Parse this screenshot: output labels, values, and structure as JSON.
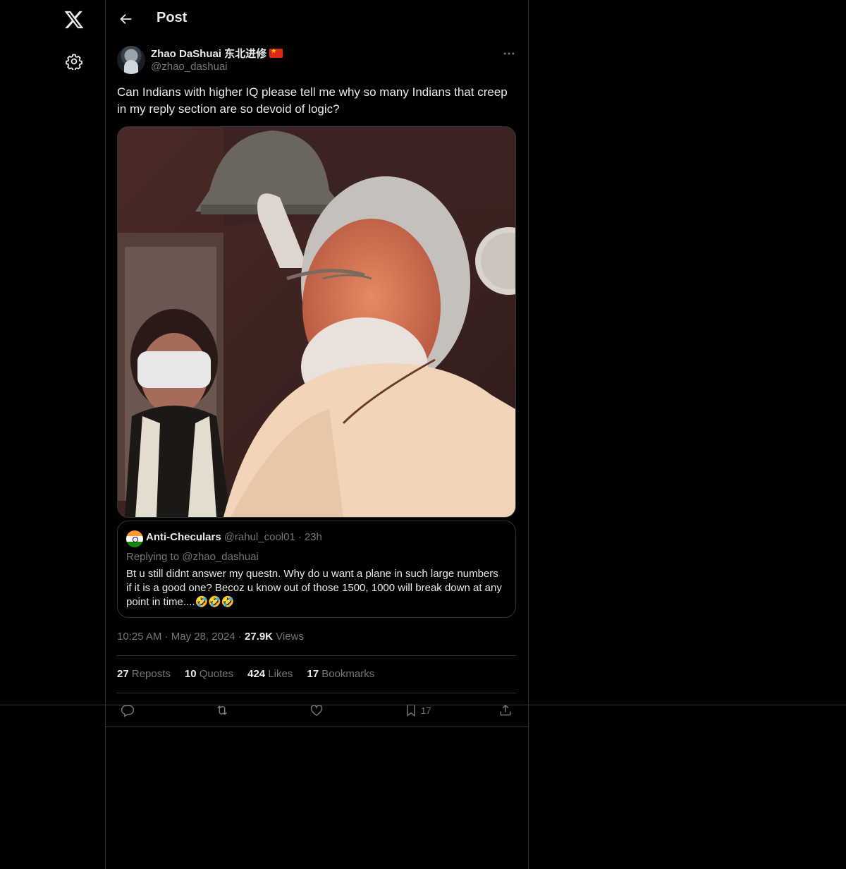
{
  "nav": {
    "logo_icon": "x-logo-icon",
    "settings_icon": "gear-icon"
  },
  "header": {
    "title": "Post",
    "back_icon": "arrow-left-icon"
  },
  "tweet": {
    "author_name": "Zhao DaShuai 东北进修",
    "author_flag": "china-flag-emoji",
    "handle": "@zhao_dashuai",
    "text": "Can Indians with higher IQ please tell me why so many Indians that creep in my reply section are so devoid of logic?",
    "media_alt": "photo",
    "time": "10:25 AM",
    "date": "May 28, 2024",
    "views_count": "27.9K",
    "views_label": "Views"
  },
  "quote": {
    "flag": "india-flag-emoji",
    "name": "Anti-Checulars",
    "handle": "@rahul_cool01",
    "sep": "·",
    "age": "23h",
    "replying": "Replying to @zhao_dashuai",
    "text": "Bt u still didnt answer my questn. Why do u want a plane in such large numbers if it is a good one? Becoz u know out of those 1500, 1000 will break down at any point in time....🤣🤣🤣"
  },
  "stats": {
    "reposts_count": "27",
    "reposts_label": "Reposts",
    "quotes_count": "10",
    "quotes_label": "Quotes",
    "likes_count": "424",
    "likes_label": "Likes",
    "bookmarks_count": "17",
    "bookmarks_label": "Bookmarks"
  },
  "actions": {
    "reply_icon": "reply-icon",
    "repost_icon": "repost-icon",
    "like_icon": "heart-icon",
    "bookmark_icon": "bookmark-icon",
    "bookmark_count": "17",
    "share_icon": "share-icon"
  },
  "colors": {
    "background": "#000000",
    "text": "#e7e9ea",
    "muted": "#71767b",
    "border": "#2f3336"
  }
}
